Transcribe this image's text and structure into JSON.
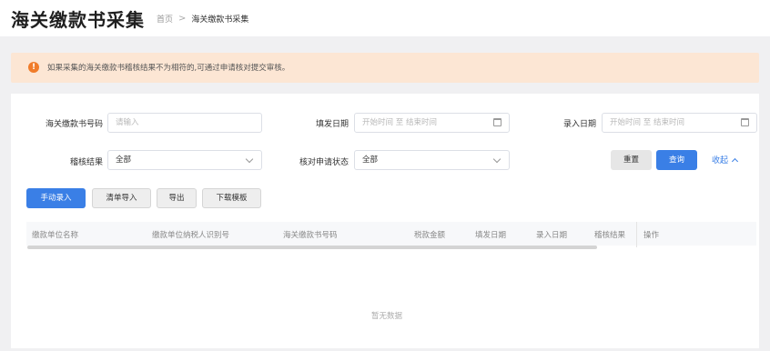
{
  "header": {
    "title": "海关缴款书采集",
    "breadcrumb": {
      "home": "首页",
      "separator": ">",
      "current": "海关缴款书采集"
    }
  },
  "notice": {
    "icon": "warning-circle-icon",
    "text": "如果采集的海关缴款书稽核结果不为相符的,可通过申请核对提交审核。"
  },
  "filters": {
    "customs_no": {
      "label": "海关缴款书号码",
      "placeholder": "请输入"
    },
    "fill_date": {
      "label": "填发日期",
      "start": "开始时间",
      "to": "至",
      "end": "结束时间"
    },
    "entry_date": {
      "label": "录入日期",
      "start": "开始时间",
      "to": "至",
      "end": "结束时间"
    },
    "audit_result": {
      "label": "稽核结果",
      "value": "全部"
    },
    "check_status": {
      "label": "核对申请状态",
      "value": "全部"
    },
    "reset_label": "重置",
    "query_label": "查询",
    "collapse_label": "收起"
  },
  "toolbar": {
    "manual_entry": "手动录入",
    "list_import": "清单导入",
    "export": "导出",
    "download_template": "下载模板"
  },
  "table": {
    "columns": [
      "缴款单位名称",
      "缴款单位纳税人识别号",
      "海关缴款书号码",
      "税款金额",
      "填发日期",
      "录入日期",
      "稽核结果",
      "操作"
    ],
    "empty_text": "暂无数据"
  },
  "colors": {
    "accent": "#3a7fe6",
    "notice_bg": "#fce6d4",
    "notice_icon": "#f07c2a"
  }
}
